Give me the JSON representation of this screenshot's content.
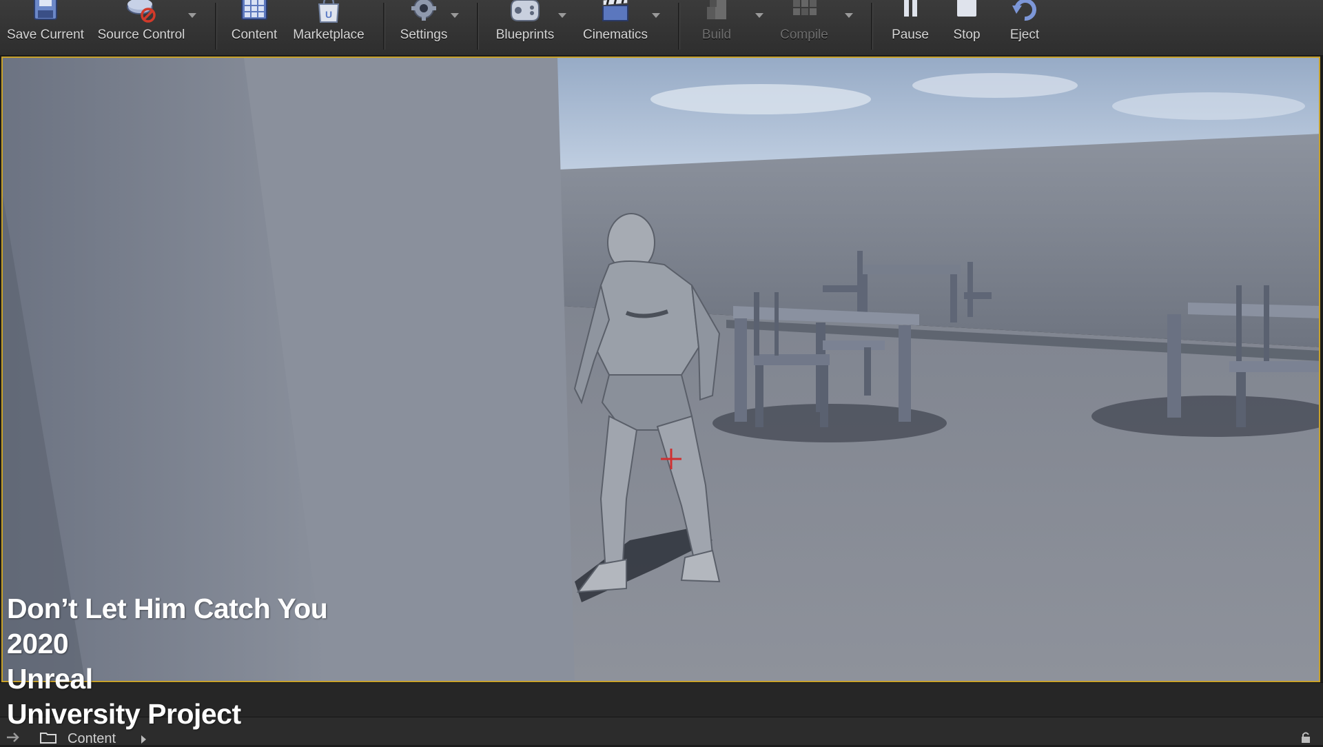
{
  "toolbar": {
    "save_current": "Save Current",
    "source_control": "Source Control",
    "content": "Content",
    "marketplace": "Marketplace",
    "settings": "Settings",
    "blueprints": "Blueprints",
    "cinematics": "Cinematics",
    "build": "Build",
    "compile": "Compile",
    "pause": "Pause",
    "stop": "Stop",
    "eject": "Eject"
  },
  "overlay": {
    "line1": "Don’t Let Him Catch You",
    "line2": "2020",
    "line3": "Unreal",
    "line4": "University Project"
  },
  "content_browser": {
    "path_label": "Content"
  },
  "colors": {
    "viewport_border": "#c7a12a",
    "crosshair": "#d03030"
  },
  "icons": [
    "save-icon",
    "source-control-icon",
    "content-icon",
    "marketplace-icon",
    "settings-icon",
    "blueprints-icon",
    "cinematics-icon",
    "build-icon",
    "compile-icon",
    "pause-icon",
    "stop-icon",
    "eject-icon",
    "folder-icon",
    "lock-icon"
  ]
}
